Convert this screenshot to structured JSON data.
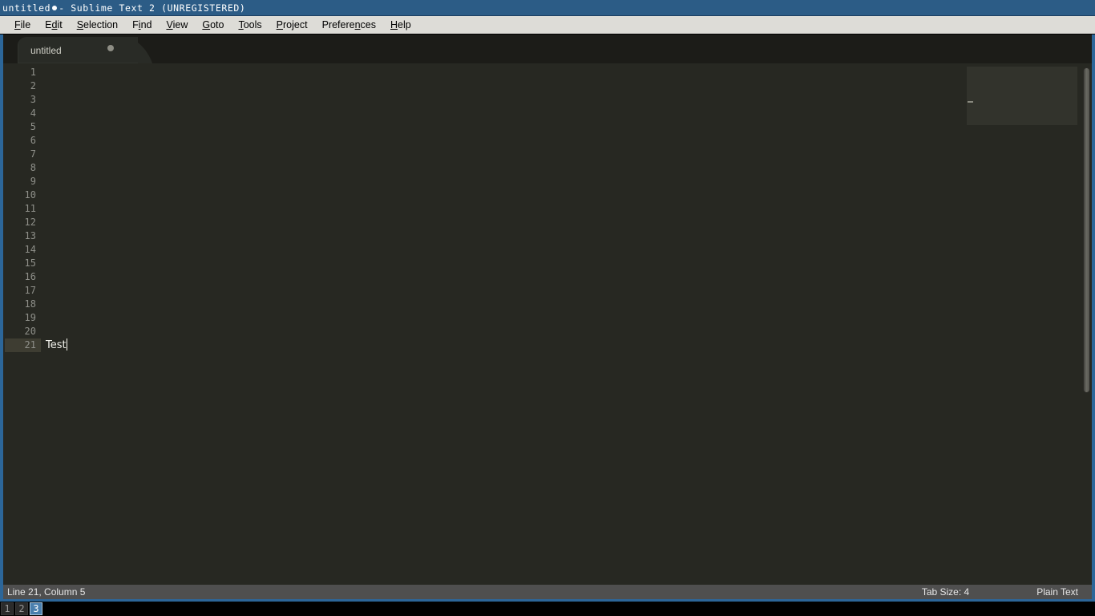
{
  "window": {
    "title_prefix": "untitled",
    "title_suffix": "- Sublime Text 2 (UNREGISTERED)",
    "accent_color": "#2c6699",
    "titlebar_color": "#2c5c86"
  },
  "menubar": {
    "items": [
      {
        "label": "File",
        "mnemonic_index": 0
      },
      {
        "label": "Edit",
        "mnemonic_index": 1
      },
      {
        "label": "Selection",
        "mnemonic_index": 0
      },
      {
        "label": "Find",
        "mnemonic_index": 1
      },
      {
        "label": "View",
        "mnemonic_index": 0
      },
      {
        "label": "Goto",
        "mnemonic_index": 0
      },
      {
        "label": "Tools",
        "mnemonic_index": 0
      },
      {
        "label": "Project",
        "mnemonic_index": 0
      },
      {
        "label": "Preferences",
        "mnemonic_index": 8
      },
      {
        "label": "Help",
        "mnemonic_index": 0
      }
    ]
  },
  "tabs": [
    {
      "label": "untitled",
      "dirty": true,
      "active": true
    }
  ],
  "editor": {
    "background": "#272822",
    "total_lines": 21,
    "line_numbers": [
      "1",
      "2",
      "3",
      "4",
      "5",
      "6",
      "7",
      "8",
      "9",
      "10",
      "11",
      "12",
      "13",
      "14",
      "15",
      "16",
      "17",
      "18",
      "19",
      "20",
      "21"
    ],
    "lines": [
      {
        "number": "1",
        "text": ""
      },
      {
        "number": "2",
        "text": ""
      },
      {
        "number": "3",
        "text": ""
      },
      {
        "number": "4",
        "text": ""
      },
      {
        "number": "5",
        "text": ""
      },
      {
        "number": "6",
        "text": ""
      },
      {
        "number": "7",
        "text": ""
      },
      {
        "number": "8",
        "text": ""
      },
      {
        "number": "9",
        "text": ""
      },
      {
        "number": "10",
        "text": ""
      },
      {
        "number": "11",
        "text": ""
      },
      {
        "number": "12",
        "text": ""
      },
      {
        "number": "13",
        "text": ""
      },
      {
        "number": "14",
        "text": ""
      },
      {
        "number": "15",
        "text": ""
      },
      {
        "number": "16",
        "text": ""
      },
      {
        "number": "17",
        "text": ""
      },
      {
        "number": "18",
        "text": ""
      },
      {
        "number": "19",
        "text": ""
      },
      {
        "number": "20",
        "text": ""
      },
      {
        "number": "21",
        "text": "Test"
      }
    ],
    "active_line": "21",
    "caret_line": 21,
    "caret_column": 5
  },
  "statusbar": {
    "cursor_position": "Line 21, Column 5",
    "tab_size": "Tab Size: 4",
    "syntax": "Plain Text"
  },
  "pager": {
    "workspaces": [
      {
        "label": "1",
        "active": false
      },
      {
        "label": "2",
        "active": false
      },
      {
        "label": "3",
        "active": true
      }
    ]
  }
}
